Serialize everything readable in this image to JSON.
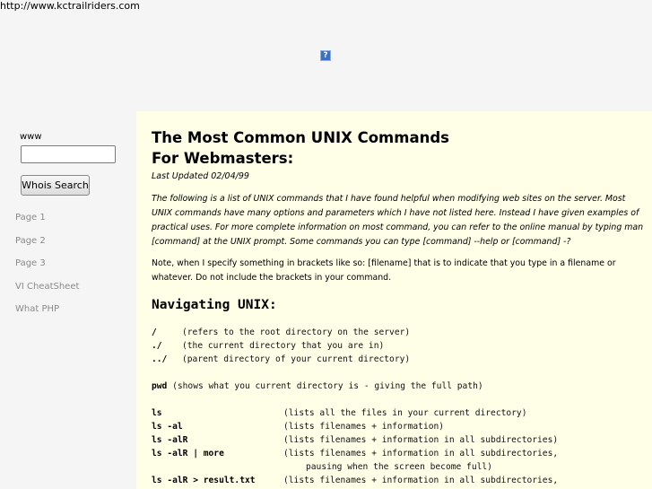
{
  "url_text": "http://www.kctrailriders.com",
  "ad_icon": "?",
  "sidebar": {
    "www_label": "www",
    "whois_input_value": "",
    "whois_button_label": "Whois Search",
    "nav": [
      "Page 1",
      "Page 2",
      "Page 3",
      "VI CheatSheet",
      "What PHP"
    ]
  },
  "main": {
    "title_line1": "The Most Common UNIX Commands",
    "title_line2": "For Webmasters:",
    "updated": "Last Updated 02/04/99",
    "intro": "The following is a list of UNIX commands that I have found helpful when modifying web sites on the server. Most UNIX commands have many options and parameters which I have not listed here. Instead I have given examples of practical uses. For more complete information on most command, you can refer to the online manual by typing man [command] at the UNIX prompt. Some commands you can type [command] --help or [command] -?",
    "note": "Note, when I specify something in brackets like so: [filename] that is to indicate that you type in a filename or whatever. Do not include the brackets in your command.",
    "section_title": "Navigating UNIX:",
    "dirs": [
      {
        "cmd": "/",
        "desc": "(refers to the root directory on the server)"
      },
      {
        "cmd": "./",
        "desc": "(the current directory that you are in)"
      },
      {
        "cmd": "../",
        "desc": "(parent directory of your current directory)"
      }
    ],
    "pwd": {
      "cmd": "pwd",
      "desc": " (shows what you current directory is - giving the full path)"
    },
    "ls": [
      {
        "cmd": "ls",
        "desc": "(lists all the files in your current directory)"
      },
      {
        "cmd": "ls -al",
        "desc": "(lists filenames + information)"
      },
      {
        "cmd": "ls -alR",
        "desc": "(lists filenames + information in all subdirectories)"
      },
      {
        "cmd": "ls -alR | more",
        "desc": "(lists filenames + information in all subdirectories,"
      },
      {
        "cmd": "",
        "desc": "pausing when the screen become full)",
        "continuation": true
      },
      {
        "cmd": "ls -alR > result.txt",
        "desc": "(lists filenames + information in all subdirectories,"
      }
    ]
  }
}
